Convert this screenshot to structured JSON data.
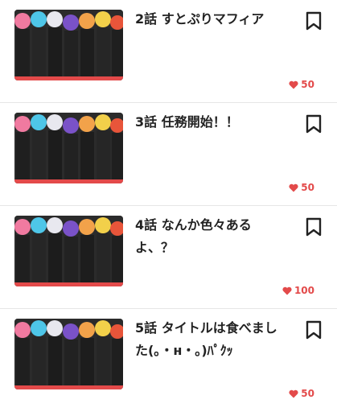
{
  "episodes": [
    {
      "title": "2話 すとぷりマフィア",
      "likes": "50"
    },
    {
      "title": "3話 任務開始！！",
      "likes": "50"
    },
    {
      "title": "4話 なんか色々あるよ、？",
      "likes": "100"
    },
    {
      "title": "5話 タイトルは食べました(｡・н・｡)ﾊﾟｸｯ",
      "likes": "50"
    }
  ],
  "icons": {
    "bookmark": "bookmark-icon",
    "heart": "heart-icon",
    "accent": "#e34a4a"
  }
}
